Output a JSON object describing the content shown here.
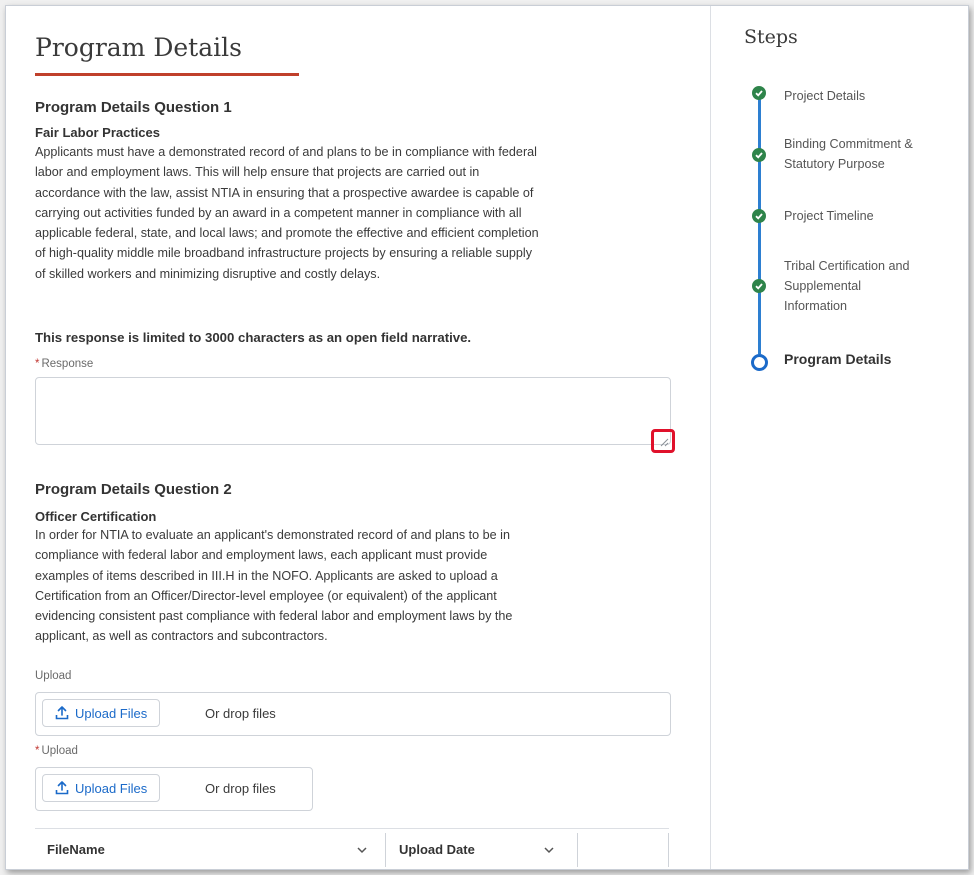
{
  "page": {
    "title": "Program Details"
  },
  "question1": {
    "heading": "Program Details Question 1",
    "subheading": "Fair Labor Practices",
    "body_lines": [
      "Applicants must have a demonstrated record of and plans to be in compliance with federal",
      "labor and employment laws. This will help ensure that projects are carried out in",
      "accordance with the law, assist NTIA in ensuring that a prospective awardee is capable of",
      "carrying out activities funded by an award in a competent manner in compliance with all",
      "applicable federal, state, and local laws; and promote the effective and efficient completion",
      "of high-quality middle mile broadband infrastructure projects by ensuring a reliable supply",
      "of skilled workers and minimizing disruptive and costly delays."
    ],
    "note": "This response is limited to 3000 characters as an open field narrative.",
    "response_label": "Response",
    "response_value": ""
  },
  "question2": {
    "heading": "Program Details Question 2",
    "subheading": "Officer Certification",
    "body_lines": [
      "In order for NTIA to evaluate an applicant's demonstrated record of and plans to be in",
      "compliance with federal labor and employment laws, each applicant must provide",
      "examples of items described in III.H in the NOFO. Applicants are asked to upload a",
      "Certification from an Officer/Director-level employee (or equivalent) of the applicant",
      "evidencing consistent past compliance with federal labor and employment laws by the",
      "applicant, as well as contractors and subcontractors."
    ],
    "upload1_label": "Upload",
    "upload2_label": "Upload",
    "upload_button_label": "Upload Files",
    "drop_text": "Or drop files"
  },
  "files_table": {
    "columns": [
      "FileName",
      "Upload Date",
      ""
    ]
  },
  "steps": {
    "title": "Steps",
    "items": [
      {
        "lines": [
          "Project Details"
        ],
        "status": "complete"
      },
      {
        "lines": [
          "Binding Commitment &",
          "Statutory Purpose"
        ],
        "status": "complete"
      },
      {
        "lines": [
          "Project Timeline"
        ],
        "status": "complete"
      },
      {
        "lines": [
          "Tribal Certification and",
          "Supplemental",
          "Information"
        ],
        "status": "complete"
      },
      {
        "lines": [
          "Program Details"
        ],
        "status": "current"
      }
    ]
  },
  "colors": {
    "accent_rule": "#c0402b",
    "link_blue": "#1b6ac9",
    "step_complete": "#2e844a",
    "step_line": "#2d7fd1",
    "highlight_box": "#e0112b",
    "required_star": "#c23934"
  }
}
